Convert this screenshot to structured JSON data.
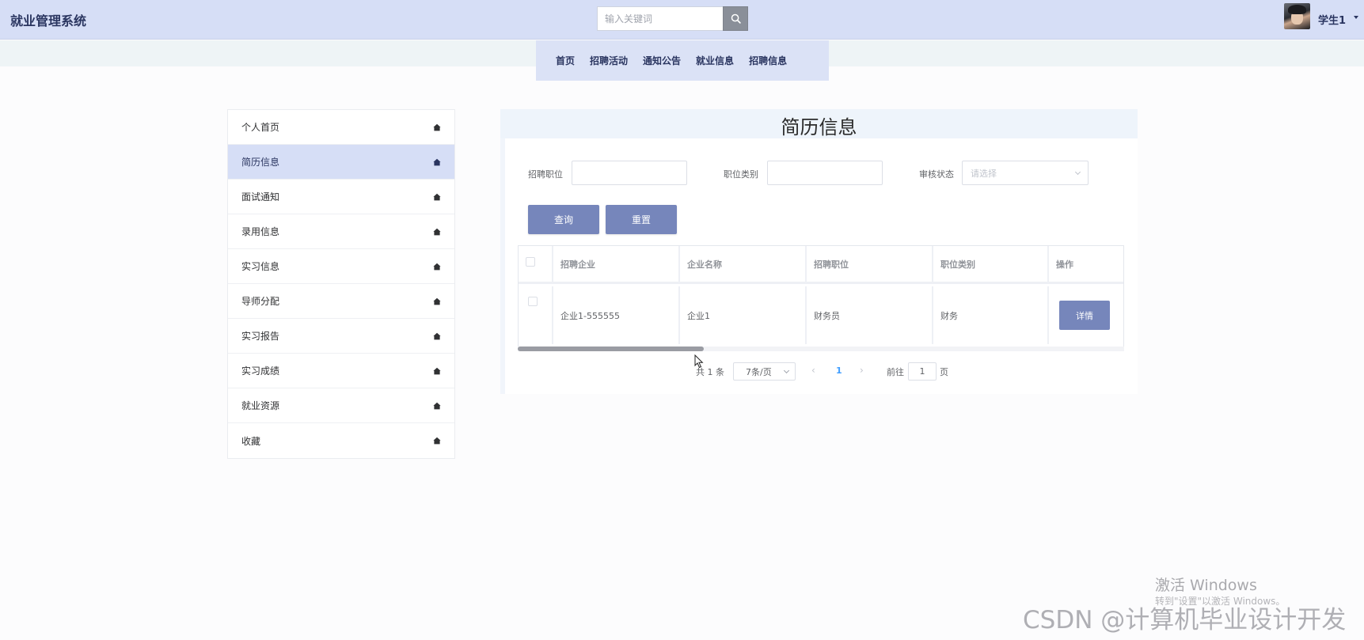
{
  "header": {
    "brand": "就业管理系统",
    "search_placeholder": "输入关键词",
    "user_name": "学生1"
  },
  "nav": {
    "items": [
      "首页",
      "招聘活动",
      "通知公告",
      "就业信息",
      "招聘信息"
    ]
  },
  "sidebar": {
    "items": [
      {
        "label": "个人首页",
        "icon": "home-icon"
      },
      {
        "label": "简历信息",
        "icon": "home-icon",
        "active": true
      },
      {
        "label": "面试通知",
        "icon": "home-icon"
      },
      {
        "label": "录用信息",
        "icon": "home-icon"
      },
      {
        "label": "实习信息",
        "icon": "home-icon"
      },
      {
        "label": "导师分配",
        "icon": "home-icon"
      },
      {
        "label": "实习报告",
        "icon": "home-icon"
      },
      {
        "label": "实习成绩",
        "icon": "home-icon"
      },
      {
        "label": "就业资源",
        "icon": "home-icon"
      },
      {
        "label": "收藏",
        "icon": "home-icon"
      }
    ]
  },
  "main": {
    "title": "简历信息",
    "filters": {
      "position_label": "招聘职位",
      "position_value": "",
      "category_label": "职位类别",
      "category_value": "",
      "status_label": "审核状态",
      "status_placeholder": "请选择"
    },
    "buttons": {
      "query": "查询",
      "reset": "重置"
    },
    "table": {
      "columns": [
        "招聘企业",
        "企业名称",
        "招聘职位",
        "职位类别",
        "操作"
      ],
      "rows": [
        {
          "company_account": "企业1-555555",
          "company_name": "企业1",
          "position": "财务员",
          "category": "财务",
          "action": "详情"
        }
      ]
    },
    "pagination": {
      "total": "共 1 条",
      "page_size": "7条/页",
      "current_page": "1",
      "goto_label": "前往",
      "goto_value": "1",
      "page_suffix": "页",
      "prev_icon": "chevron-left-icon",
      "next_icon": "chevron-right-icon"
    }
  },
  "overlays": {
    "windows_activate_title": "激活 Windows",
    "windows_activate_sub": "转到\"设置\"以激活 Windows。",
    "watermark": "CSDN @计算机毕业设计开发"
  },
  "colors": {
    "header_bg": "#d6def6",
    "accent_button": "#7686bb",
    "active_sidebar": "#d6def6",
    "page_active": "#409eff"
  }
}
